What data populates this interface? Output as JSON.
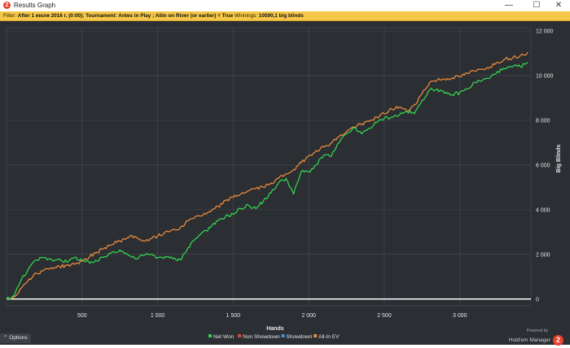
{
  "window": {
    "title": "Results Graph",
    "app_icon_glyph": "2",
    "minimize_glyph": "—",
    "maximize_glyph": "☐",
    "close_glyph": "✕"
  },
  "filter": {
    "prefix": "Filter: ",
    "criteria": "After 1 июля 2016 г. (0:00); Tournament: Antes in Play ; Allin on River (or earlier) = True",
    "winnings_label": " Winnings: ",
    "winnings_value": "10590,1 big blinds"
  },
  "options_button": {
    "icon_glyph": "⌃",
    "label": "Options"
  },
  "brand": {
    "powered_by": "Powered by",
    "name": "Hold'em Manager",
    "logo_glyph": "2"
  },
  "colors": {
    "background": "#2b2e33",
    "grid": "#4a4e55",
    "net_won": "#33d14f",
    "non_showdown": "#e0443a",
    "showdown": "#3f8fe0",
    "all_in_ev": "#e8883a",
    "zero_line": "#ffffff",
    "filter_bar": "#f5c84a"
  },
  "chart_data": {
    "type": "line",
    "xlabel": "Hands",
    "ylabel": "Big Blinds",
    "xlim": [
      0,
      3470
    ],
    "ylim": [
      -300,
      12150
    ],
    "x_ticks": [
      500,
      1000,
      1500,
      2000,
      2500,
      3000
    ],
    "x_tick_labels": [
      "500",
      "1 000",
      "1 500",
      "2 000",
      "2 500",
      "3 000"
    ],
    "y_ticks": [
      0,
      2000,
      4000,
      6000,
      8000,
      10000,
      12000
    ],
    "y_tick_labels": [
      "0",
      "2 000",
      "4 000",
      "6 000",
      "8 000",
      "10 000",
      "12 000"
    ],
    "grid": true,
    "legend_position": "bottom-center",
    "legend": [
      {
        "name": "Net Won",
        "color": "#33d14f"
      },
      {
        "name": "Non Showdown",
        "color": "#e0443a"
      },
      {
        "name": "Showdown",
        "color": "#3f8fe0"
      },
      {
        "name": "All-In EV",
        "color": "#e8883a"
      }
    ],
    "series": [
      {
        "name": "Net Won",
        "color": "#33d14f",
        "x": [
          0,
          50,
          100,
          150,
          200,
          250,
          300,
          350,
          400,
          450,
          500,
          550,
          600,
          650,
          700,
          750,
          800,
          850,
          900,
          950,
          1000,
          1050,
          1100,
          1150,
          1200,
          1250,
          1300,
          1350,
          1400,
          1450,
          1500,
          1550,
          1600,
          1650,
          1700,
          1750,
          1800,
          1850,
          1900,
          1950,
          2000,
          2050,
          2100,
          2150,
          2200,
          2250,
          2300,
          2350,
          2400,
          2450,
          2500,
          2550,
          2600,
          2650,
          2700,
          2750,
          2800,
          2850,
          2900,
          2950,
          3000,
          3050,
          3100,
          3150,
          3200,
          3250,
          3300,
          3350,
          3400,
          3450
        ],
        "values": [
          0,
          150,
          900,
          1400,
          1750,
          1850,
          1750,
          1800,
          1650,
          1850,
          1750,
          1600,
          1700,
          1900,
          2100,
          2200,
          2000,
          1800,
          1950,
          2000,
          1850,
          1900,
          1800,
          1750,
          2300,
          2700,
          3000,
          3200,
          3500,
          3700,
          3800,
          4050,
          4200,
          4050,
          4400,
          4750,
          5200,
          5400,
          4700,
          5700,
          5700,
          6000,
          6450,
          6400,
          7000,
          7400,
          7650,
          7400,
          7650,
          7900,
          8100,
          8150,
          8250,
          8400,
          8300,
          8900,
          9350,
          9400,
          9200,
          9150,
          9250,
          9400,
          9700,
          9800,
          9900,
          10200,
          10300,
          10400,
          10400,
          10600
        ]
      },
      {
        "name": "All-In EV",
        "color": "#e8883a",
        "x": [
          0,
          50,
          100,
          150,
          200,
          250,
          300,
          350,
          400,
          450,
          500,
          550,
          600,
          650,
          700,
          750,
          800,
          850,
          900,
          950,
          1000,
          1050,
          1100,
          1150,
          1200,
          1250,
          1300,
          1350,
          1400,
          1450,
          1500,
          1550,
          1600,
          1650,
          1700,
          1750,
          1800,
          1850,
          1900,
          1950,
          2000,
          2050,
          2100,
          2150,
          2200,
          2250,
          2300,
          2350,
          2400,
          2450,
          2500,
          2550,
          2600,
          2650,
          2700,
          2750,
          2800,
          2850,
          2900,
          2950,
          3000,
          3050,
          3100,
          3150,
          3200,
          3250,
          3300,
          3350,
          3400,
          3450
        ],
        "values": [
          0,
          100,
          500,
          900,
          1150,
          1300,
          1400,
          1450,
          1500,
          1550,
          1700,
          1900,
          2100,
          2300,
          2450,
          2600,
          2750,
          2800,
          2600,
          2700,
          2800,
          3000,
          3100,
          3200,
          3500,
          3700,
          3750,
          3900,
          4150,
          4400,
          4550,
          4700,
          4850,
          4950,
          5000,
          5200,
          5400,
          5600,
          5800,
          6100,
          6400,
          6650,
          6800,
          7000,
          7250,
          7500,
          7700,
          7850,
          7950,
          8150,
          8300,
          8500,
          8600,
          8400,
          8700,
          9200,
          9700,
          9800,
          9850,
          9900,
          9950,
          10100,
          10200,
          10300,
          10400,
          10600,
          10750,
          10800,
          10900,
          11050
        ]
      }
    ]
  }
}
